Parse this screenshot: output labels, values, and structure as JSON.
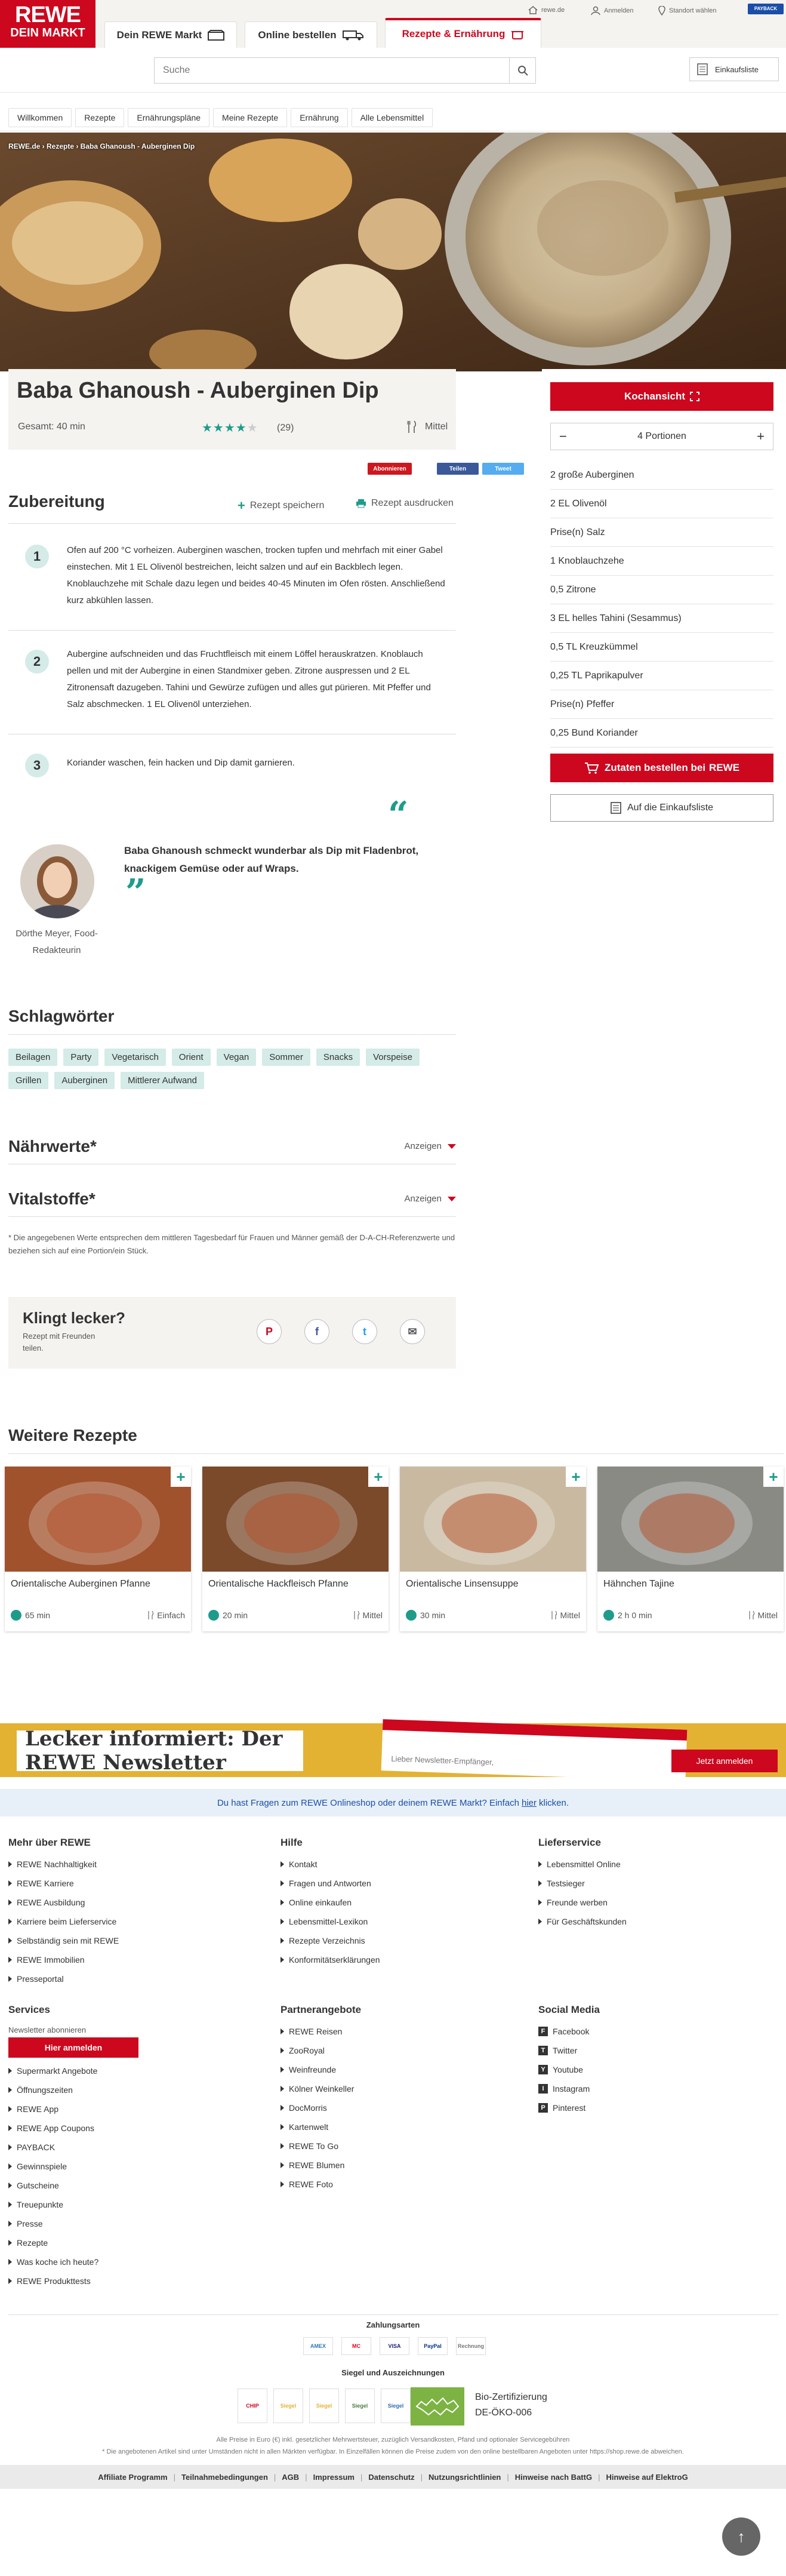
{
  "header": {
    "logo_line1": "REWE",
    "logo_line2": "DEIN MARKT",
    "tabs": [
      {
        "label": "Dein REWE Markt"
      },
      {
        "label": "Online bestellen"
      },
      {
        "label": "Rezepte & Ernährung"
      }
    ],
    "util_rewe": "rewe.de",
    "util_login": "Anmelden",
    "util_store": "Standort wählen",
    "payback": "PAYBACK",
    "search_placeholder": "Suche",
    "shopping_list": "Einkaufsliste"
  },
  "nav": [
    "Willkommen",
    "Rezepte",
    "Ernährungspläne",
    "Meine Rezepte",
    "Ernährung",
    "Alle Lebensmittel"
  ],
  "breadcrumb": "REWE.de › Rezepte › Baba Ghanoush - Auberginen Dip",
  "recipe": {
    "title": "Baba Ghanoush - Auberginen Dip",
    "total_time": "Gesamt: 40 min",
    "rating_stars": 4,
    "rating_count": "(29)",
    "difficulty": "Mittel",
    "social": {
      "subscribe": "Abonnieren",
      "share": "Teilen",
      "tweet": "Tweet"
    }
  },
  "panel": {
    "cook_view": "Kochansicht",
    "portions": "4 Portionen",
    "minus": "−",
    "plus": "+",
    "ingredients": [
      "2 große Auberginen",
      "2 EL Olivenöl",
      "Prise(n) Salz",
      "1 Knoblauchzehe",
      "0,5 Zitrone",
      "3 EL helles Tahini (Sesammus)",
      "0,5 TL Kreuzkümmel",
      "0,25 TL Paprikapulver",
      "Prise(n) Pfeffer",
      "0,25 Bund Koriander"
    ],
    "order_button_prefix": "Zutaten bestellen bei",
    "order_button_brand": "REWE",
    "add_to_list": "Auf die Einkaufsliste"
  },
  "preparation": {
    "heading": "Zubereitung",
    "save": "Rezept speichern",
    "print": "Rezept ausdrucken",
    "steps": [
      {
        "num": "1",
        "text": "Ofen auf 200 °C vorheizen. Auberginen waschen, trocken tupfen und mehrfach mit einer Gabel einstechen. Mit 1 EL Olivenöl bestreichen, leicht salzen und auf ein Backblech legen. Knoblauchzehe mit Schale dazu legen und beides 40-45 Minuten im Ofen rösten. Anschließend kurz abkühlen lassen."
      },
      {
        "num": "2",
        "text": "Aubergine aufschneiden und das Fruchtfleisch mit einem Löffel herauskratzen. Knoblauch pellen und mit der Aubergine in einen Standmixer geben. Zitrone auspressen und 2 EL Zitronensaft dazugeben. Tahini und Gewürze zufügen und alles gut pürieren. Mit Pfeffer und Salz abschmecken. 1 EL Olivenöl unterziehen."
      },
      {
        "num": "3",
        "text": "Koriander waschen, fein hacken und Dip damit garnieren."
      }
    ]
  },
  "editor": {
    "quote": "Baba Ghanoush schmeckt wunderbar als Dip mit Fladenbrot, knackigem Gemüse oder auf Wraps.",
    "name": "Dörthe Meyer, Food-Redakteurin"
  },
  "keywords": {
    "heading": "Schlagwörter",
    "tags": [
      "Beilagen",
      "Party",
      "Vegetarisch",
      "Orient",
      "Vegan",
      "Sommer",
      "Snacks",
      "Vorspeise",
      "Grillen",
      "Auberginen",
      "Mittlerer Aufwand"
    ]
  },
  "nutrition": {
    "heading": "Nährwerte*",
    "show": "Anzeigen"
  },
  "vitals": {
    "heading": "Vitalstoffe*",
    "show": "Anzeigen"
  },
  "footnote": "* Die angegebenen Werte entsprechen dem mittleren Tagesbedarf für Frauen und Männer gemäß der D-A-CH-Referenzwerte und beziehen sich auf eine Portion/ein Stück.",
  "share": {
    "heading": "Klingt lecker?",
    "sub": "Rezept mit Freunden teilen.",
    "icons": [
      {
        "name": "pinterest-icon",
        "glyph": "P"
      },
      {
        "name": "facebook-icon",
        "glyph": "f"
      },
      {
        "name": "twitter-icon",
        "glyph": "t"
      },
      {
        "name": "mail-icon",
        "glyph": "✉"
      }
    ]
  },
  "more": {
    "heading": "Weitere Rezepte",
    "cards": [
      {
        "title": "Orientalische Auberginen Pfanne",
        "time": "65 min",
        "difficulty": "Einfach",
        "color": "#a0522d"
      },
      {
        "title": "Orientalische Hackfleisch Pfanne",
        "time": "20 min",
        "difficulty": "Mittel",
        "color": "#7a4a2a"
      },
      {
        "title": "Orientalische Linsensuppe",
        "time": "30 min",
        "difficulty": "Mittel",
        "color": "#c9b9a0"
      },
      {
        "title": "Hähnchen Tajine",
        "time": "2 h 0 min",
        "difficulty": "Mittel",
        "color": "#8a8a85"
      }
    ]
  },
  "newsletter": {
    "title": "Lecker informiert: Der REWE Newsletter",
    "button": "Jetzt anmelden",
    "card_text": "Lieber Newsletter-Empfänger,"
  },
  "helpbar": {
    "text": "Du hast Fragen zum REWE Onlineshop oder deinem REWE Markt? Einfach ",
    "link": "hier",
    "suffix": " klicken."
  },
  "footer": {
    "col1": {
      "heading": "Mehr über REWE",
      "links": [
        "REWE Nachhaltigkeit",
        "REWE Karriere",
        "REWE Ausbildung",
        "Karriere beim Lieferservice",
        "Selbständig sein mit REWE",
        "REWE Immobilien",
        "Presseportal"
      ]
    },
    "col2": {
      "heading": "Hilfe",
      "links": [
        "Kontakt",
        "Fragen und Antworten",
        "Online einkaufen",
        "Lebensmittel-Lexikon",
        "Rezepte Verzeichnis",
        "Konformitätserklärungen"
      ]
    },
    "col3": {
      "heading": "Lieferservice",
      "links": [
        "Lebensmittel Online",
        "Testsieger",
        "Freunde werben",
        "Für Geschäftskunden"
      ]
    },
    "col4": {
      "heading": "Services",
      "newsletter_label": "Newsletter abonnieren",
      "newsletter_button": "Hier anmelden",
      "links": [
        "Supermarkt Angebote",
        "Öffnungszeiten",
        "REWE App",
        "REWE App Coupons",
        "PAYBACK",
        "Gewinnspiele",
        "Gutscheine",
        "Treuepunkte",
        "Presse",
        "Rezepte",
        "Was koche ich heute?",
        "REWE Produkttests"
      ]
    },
    "col5": {
      "heading": "Partnerangebote",
      "links": [
        "REWE Reisen",
        "ZooRoyal",
        "Weinfreunde",
        "Kölner Weinkeller",
        "DocMorris",
        "Kartenwelt",
        "REWE To Go",
        "REWE Blumen",
        "REWE Foto"
      ]
    },
    "col6": {
      "heading": "Social Media",
      "links": [
        "Facebook",
        "Twitter",
        "Youtube",
        "Instagram",
        "Pinterest"
      ]
    },
    "payment_heading": "Zahlungsarten",
    "payments": [
      "AMEX",
      "MC",
      "VISA",
      "PayPal",
      "Rechnung"
    ],
    "seals_heading": "Siegel und Auszeichnungen",
    "seals": [
      "CHIP",
      "Siegel",
      "Siegel",
      "Siegel",
      "Siegel"
    ],
    "bio_title": "Bio-Zertifizierung",
    "bio_code": "DE-ÖKO-006",
    "legal1": "Alle Preise in Euro (€) inkl. gesetzlicher Mehrwertsteuer, zuzüglich Versandkosten, Pfand und optionaler Servicegebühren",
    "legal2": "* Die angebotenen Artikel sind unter Umständen nicht in allen Märkten verfügbar. In Einzelfällen können die Preise zudem von den online bestellbaren Angeboten unter https://shop.rewe.de abweichen.",
    "bottom_links": [
      "Affiliate Programm",
      "Teilnahmebedingungen",
      "AGB",
      "Impressum",
      "Datenschutz",
      "Nutzungsrichtlinien",
      "Hinweise nach BattG",
      "Hinweise auf ElektroG"
    ]
  }
}
